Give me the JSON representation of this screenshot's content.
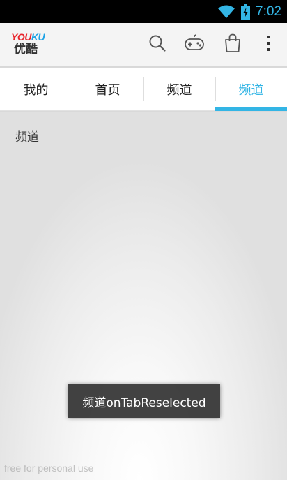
{
  "status_bar": {
    "time": "7:02",
    "icons": [
      "wifi-icon",
      "battery-charging-icon"
    ]
  },
  "action_bar": {
    "logo_brand_part1": "YOU",
    "logo_brand_part2": "KU",
    "logo_cn": "优酷",
    "icons": [
      "search-icon",
      "gamepad-icon",
      "shopping-bag-icon",
      "overflow-menu-icon"
    ]
  },
  "tabs": [
    {
      "label": "我的",
      "active": false
    },
    {
      "label": "首页",
      "active": false
    },
    {
      "label": "频道",
      "active": false
    },
    {
      "label": "频道",
      "active": true
    }
  ],
  "content": {
    "label": "频道"
  },
  "toast": {
    "text": "频道onTabReselected"
  },
  "watermark": "free for personal use",
  "colors": {
    "accent": "#33b5e5",
    "status_bar_bg": "#000000",
    "youku_red": "#e8262d",
    "youku_blue": "#1ea3e6"
  }
}
